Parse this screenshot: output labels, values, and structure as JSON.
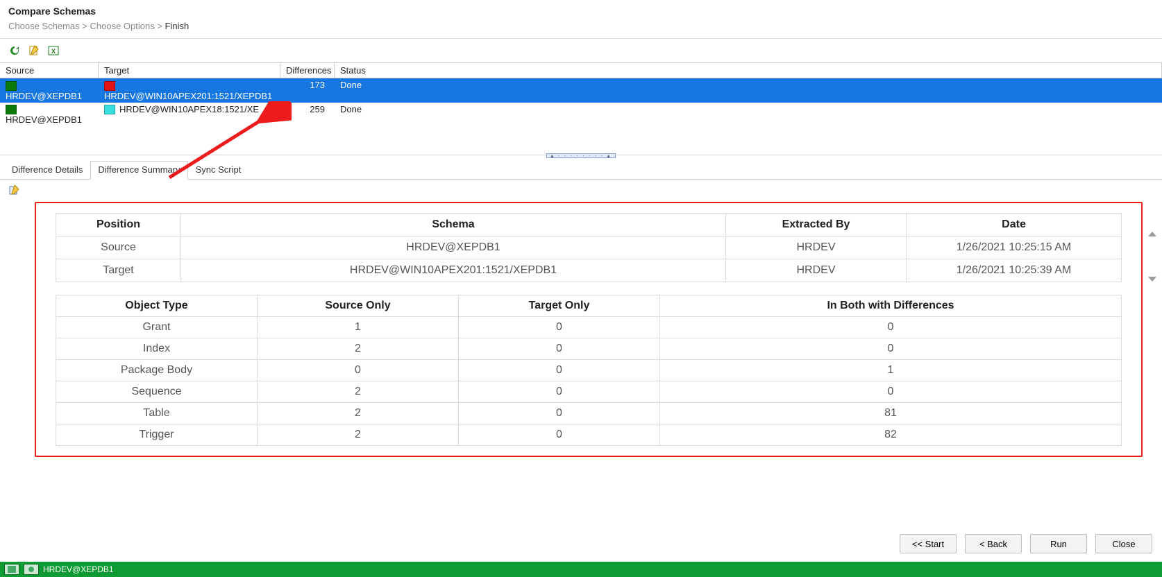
{
  "title": "Compare Schemas",
  "breadcrumb": {
    "a": "Choose Schemas",
    "b": "Choose Options",
    "current": "Finish"
  },
  "toolbar": {
    "refresh": "refresh",
    "edit": "edit",
    "excel": "excel"
  },
  "gridHeaders": {
    "source": "Source",
    "target": "Target",
    "diff": "Differences",
    "status": "Status"
  },
  "rows": [
    {
      "source": "HRDEV@XEPDB1",
      "target": "HRDEV@WIN10APEX201:1521/XEPDB1",
      "diff": "173",
      "status": "Done",
      "srcColor": "darkgreen",
      "tgtColor": "red",
      "selected": true
    },
    {
      "source": "HRDEV@XEPDB1",
      "target": "HRDEV@WIN10APEX18:1521/XE",
      "diff": "259",
      "status": "Done",
      "srcColor": "darkgreen",
      "tgtColor": "cyan",
      "selected": false
    }
  ],
  "tabs": {
    "details": "Difference Details",
    "summary": "Difference Summary",
    "sync": "Sync Script"
  },
  "summaryTable1": {
    "headers": {
      "position": "Position",
      "schema": "Schema",
      "extractedBy": "Extracted By",
      "date": "Date"
    },
    "rows": [
      {
        "position": "Source",
        "schema": "HRDEV@XEPDB1",
        "extractedBy": "HRDEV",
        "date": "1/26/2021 10:25:15 AM"
      },
      {
        "position": "Target",
        "schema": "HRDEV@WIN10APEX201:1521/XEPDB1",
        "extractedBy": "HRDEV",
        "date": "1/26/2021 10:25:39 AM"
      }
    ]
  },
  "summaryTable2": {
    "headers": {
      "objType": "Object Type",
      "srcOnly": "Source Only",
      "tgtOnly": "Target Only",
      "bothDiff": "In Both with Differences"
    },
    "rows": [
      {
        "objType": "Grant",
        "srcOnly": "1",
        "tgtOnly": "0",
        "bothDiff": "0"
      },
      {
        "objType": "Index",
        "srcOnly": "2",
        "tgtOnly": "0",
        "bothDiff": "0"
      },
      {
        "objType": "Package Body",
        "srcOnly": "0",
        "tgtOnly": "0",
        "bothDiff": "1"
      },
      {
        "objType": "Sequence",
        "srcOnly": "2",
        "tgtOnly": "0",
        "bothDiff": "0"
      },
      {
        "objType": "Table",
        "srcOnly": "2",
        "tgtOnly": "0",
        "bothDiff": "81"
      },
      {
        "objType": "Trigger",
        "srcOnly": "2",
        "tgtOnly": "0",
        "bothDiff": "82"
      }
    ]
  },
  "buttons": {
    "start": "<< Start",
    "back": "< Back",
    "run": "Run",
    "close": "Close"
  },
  "statusBar": {
    "conn": "HRDEV@XEPDB1"
  }
}
